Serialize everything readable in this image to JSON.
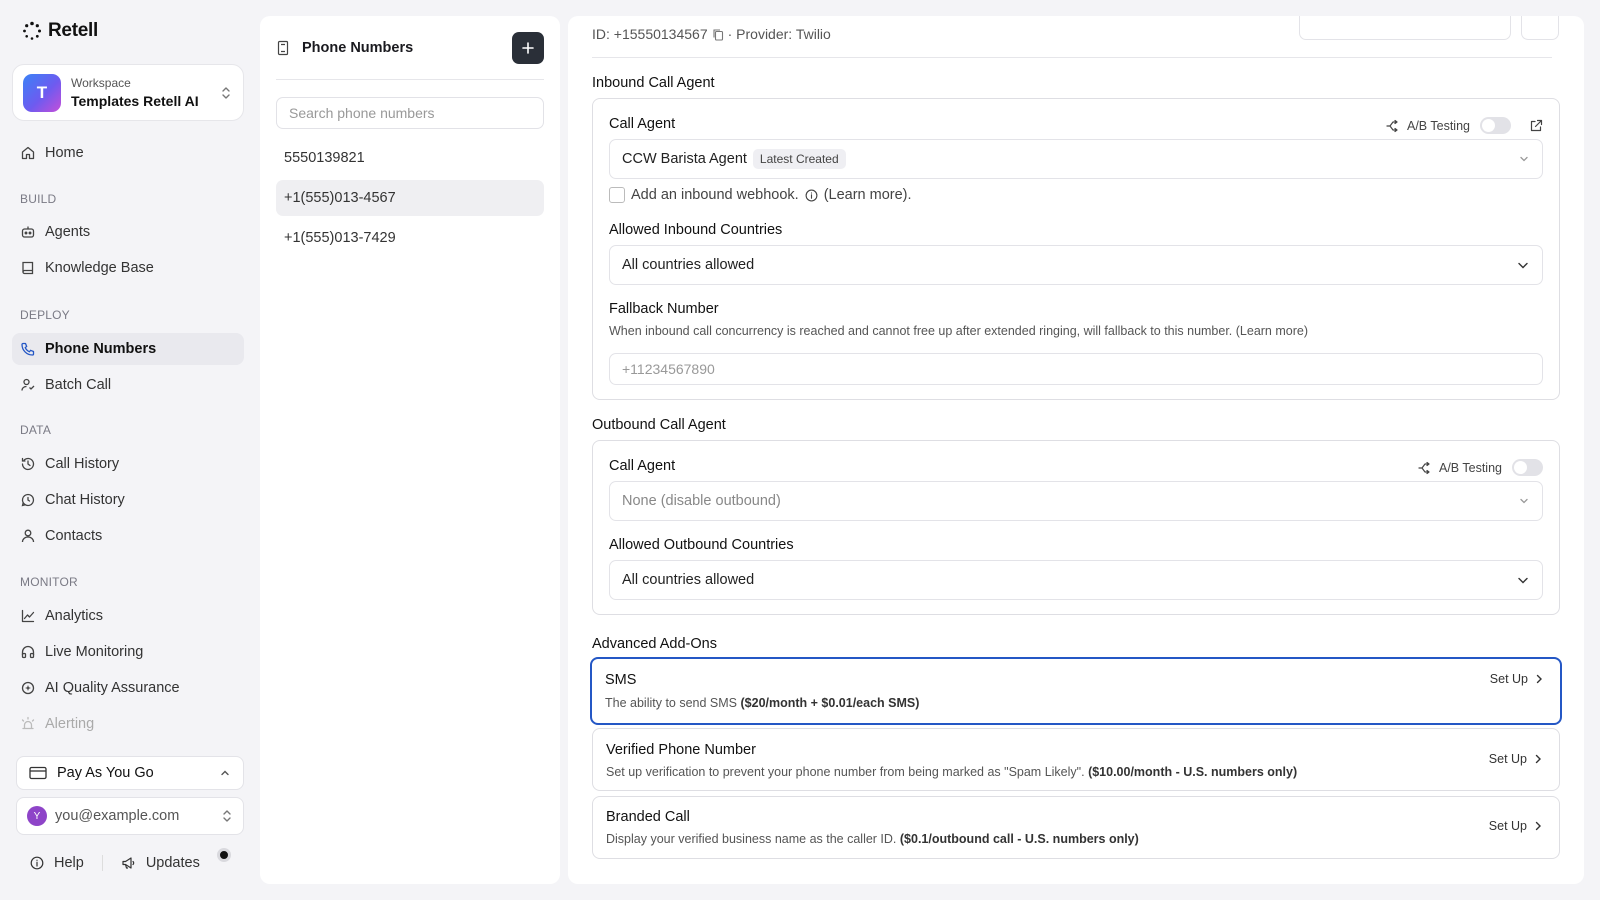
{
  "brand": {
    "name": "Retell"
  },
  "workspace": {
    "label": "Workspace",
    "name": "Templates Retell AI",
    "initial": "T"
  },
  "nav": {
    "home": "Home",
    "build_section": "BUILD",
    "agents": "Agents",
    "knowledge_base": "Knowledge Base",
    "deploy_section": "DEPLOY",
    "phone_numbers": "Phone Numbers",
    "batch_call": "Batch Call",
    "data_section": "DATA",
    "call_history": "Call History",
    "chat_history": "Chat History",
    "contacts": "Contacts",
    "monitor_section": "MONITOR",
    "analytics": "Analytics",
    "live_monitoring": "Live Monitoring",
    "ai_qa": "AI Quality Assurance",
    "alerting": "Alerting"
  },
  "plan": {
    "label": "Pay As You Go"
  },
  "user": {
    "email": "you@example.com",
    "initial": "Y"
  },
  "footer": {
    "help": "Help",
    "updates": "Updates"
  },
  "numbers_panel": {
    "title": "Phone Numbers",
    "search_placeholder": "Search phone numbers",
    "items": [
      "5550139821",
      "+1(555)013-4567",
      "+1(555)013-7429"
    ]
  },
  "detail": {
    "id_text": "ID: +15550134567",
    "provider_text": "· Provider: Twilio",
    "inbound": {
      "section_title": "Inbound Call Agent",
      "call_agent_label": "Call Agent",
      "ab_testing": "A/B Testing",
      "agent_name": "CCW Barista Agent",
      "agent_badge": "Latest Created",
      "webhook_text": "Add an inbound webhook.",
      "learn_more": "(Learn more).",
      "countries_label": "Allowed Inbound Countries",
      "countries_value": "All countries allowed",
      "fallback_label": "Fallback Number",
      "fallback_hint": "When inbound call concurrency is reached and cannot free up after extended ringing, will fallback to this number. (Learn more)",
      "fallback_placeholder": "+11234567890"
    },
    "outbound": {
      "section_title": "Outbound Call Agent",
      "call_agent_label": "Call Agent",
      "ab_testing": "A/B Testing",
      "agent_placeholder": "None (disable outbound)",
      "countries_label": "Allowed Outbound Countries",
      "countries_value": "All countries allowed"
    },
    "addons": {
      "section_title": "Advanced Add-Ons",
      "setup_label": "Set Up",
      "sms": {
        "title": "SMS",
        "desc": "The ability to send SMS",
        "price": "($20/month + $0.01/each SMS)"
      },
      "verified": {
        "title": "Verified Phone Number",
        "desc": "Set up verification to prevent your phone number from being marked as \"Spam Likely\".",
        "price": "($10.00/month - U.S. numbers only)"
      },
      "branded": {
        "title": "Branded Call",
        "desc": "Display your verified business name as the caller ID.",
        "price": "($0.1/outbound call - U.S. numbers only)"
      }
    }
  },
  "colors": {
    "accent_focus": "#2457c5",
    "active_nav_bg": "#e9e9ee",
    "add_button": "#2a2f38"
  }
}
